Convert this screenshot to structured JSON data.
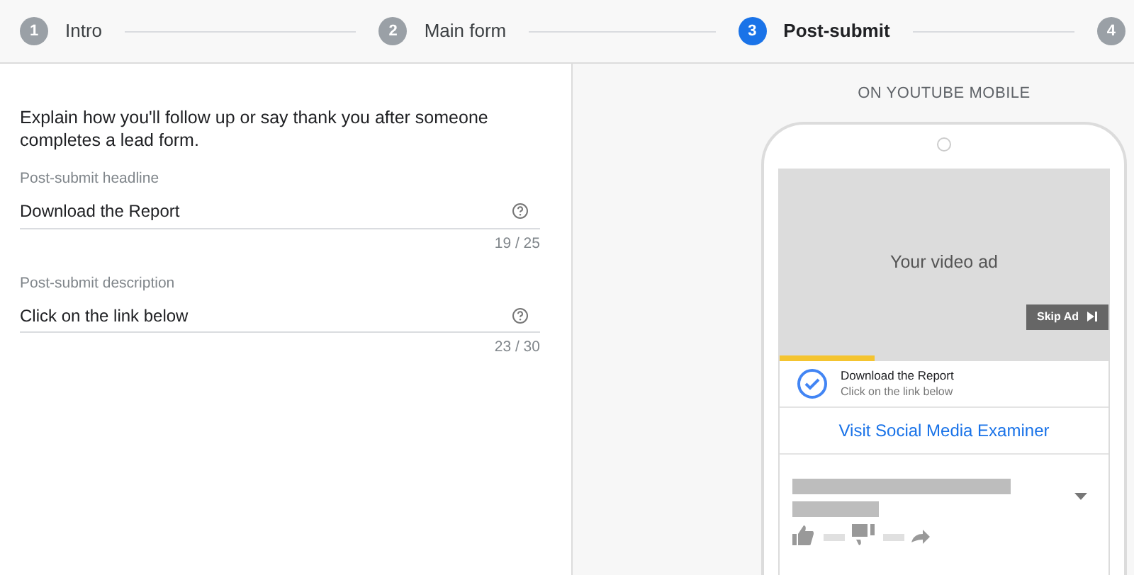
{
  "steps": [
    {
      "number": "1",
      "label": "Intro",
      "selected": false
    },
    {
      "number": "2",
      "label": "Main form",
      "selected": false
    },
    {
      "number": "3",
      "label": "Post-submit",
      "selected": true
    },
    {
      "number": "4",
      "selected": false
    }
  ],
  "intro": "Explain how you'll follow up or say thank you after someone completes a lead form.",
  "fields": [
    {
      "label": "Post-submit headline",
      "value": "Download the Report",
      "count": "19 / 25"
    },
    {
      "label": "Post-submit description",
      "value": "Click on the link below",
      "count": "23 / 30"
    }
  ],
  "preview": {
    "title": "ON YOUTUBE MOBILE",
    "video_text": "Your video ad",
    "skip_button": "Skip Ad",
    "level": 0.29,
    "card_headline": "Download the Report",
    "card_description": "Click on the link below",
    "link": "Visit Social Media Examiner"
  }
}
